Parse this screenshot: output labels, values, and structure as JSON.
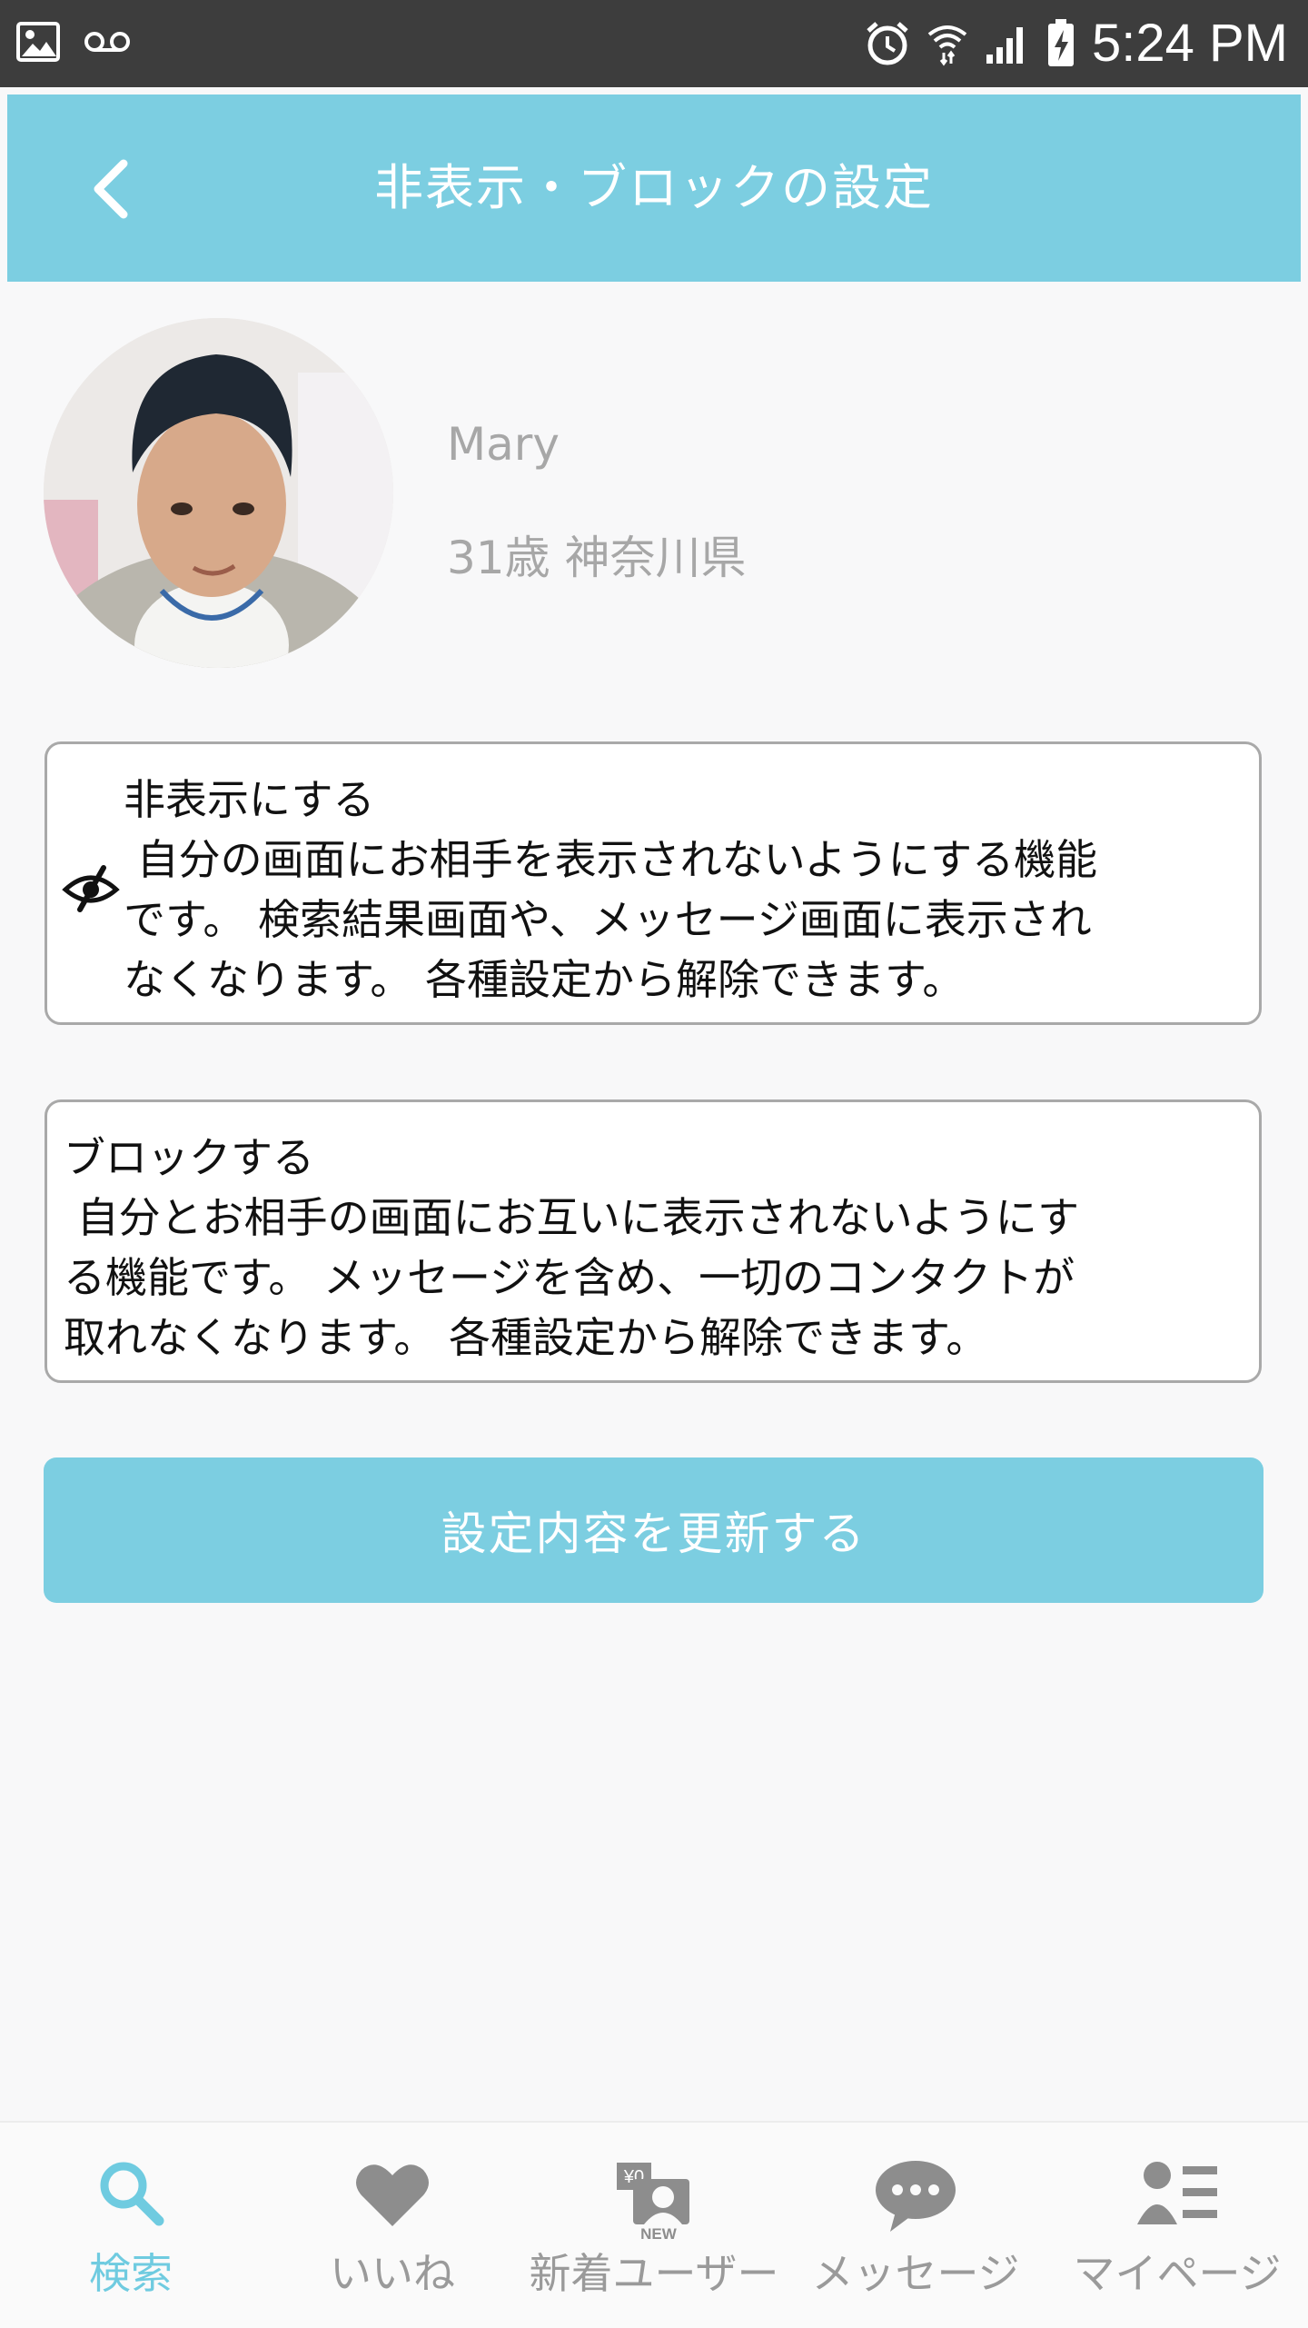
{
  "status_bar": {
    "time": "5:24 PM"
  },
  "header": {
    "title": "非表示・ブロックの設定"
  },
  "profile": {
    "name": "Mary",
    "age_location": "31歳 神奈川県"
  },
  "hide_option": {
    "title": "非表示にする",
    "description_lines": [
      " 自分の画面にお相手を表示されないようにする機能",
      "です。 検索結果画面や、メッセージ画面に表示され",
      "なくなります。 各種設定から解除できます。"
    ]
  },
  "block_option": {
    "title": "ブロックする",
    "description_lines": [
      " 自分とお相手の画面にお互いに表示されないようにす",
      "る機能です。 メッセージを含め、一切のコンタクトが",
      "取れなくなります。 各種設定から解除できます。"
    ]
  },
  "update_button": {
    "label": "設定内容を更新する"
  },
  "bottom_nav": {
    "items": [
      {
        "label": "検索",
        "icon": "search-icon",
        "active": true
      },
      {
        "label": "いいね",
        "icon": "heart-icon",
        "active": false
      },
      {
        "label": "新着ユーザー",
        "icon": "new-user-icon",
        "active": false,
        "badge_text": "¥0",
        "sub_badge": "NEW"
      },
      {
        "label": "メッセージ",
        "icon": "chat-bubble-icon",
        "active": false
      },
      {
        "label": "マイページ",
        "icon": "profile-list-icon",
        "active": false
      }
    ]
  },
  "colors": {
    "accent": "#7ccee1",
    "nav_active": "#6fcbe0",
    "muted_text": "#a7a7a7"
  }
}
